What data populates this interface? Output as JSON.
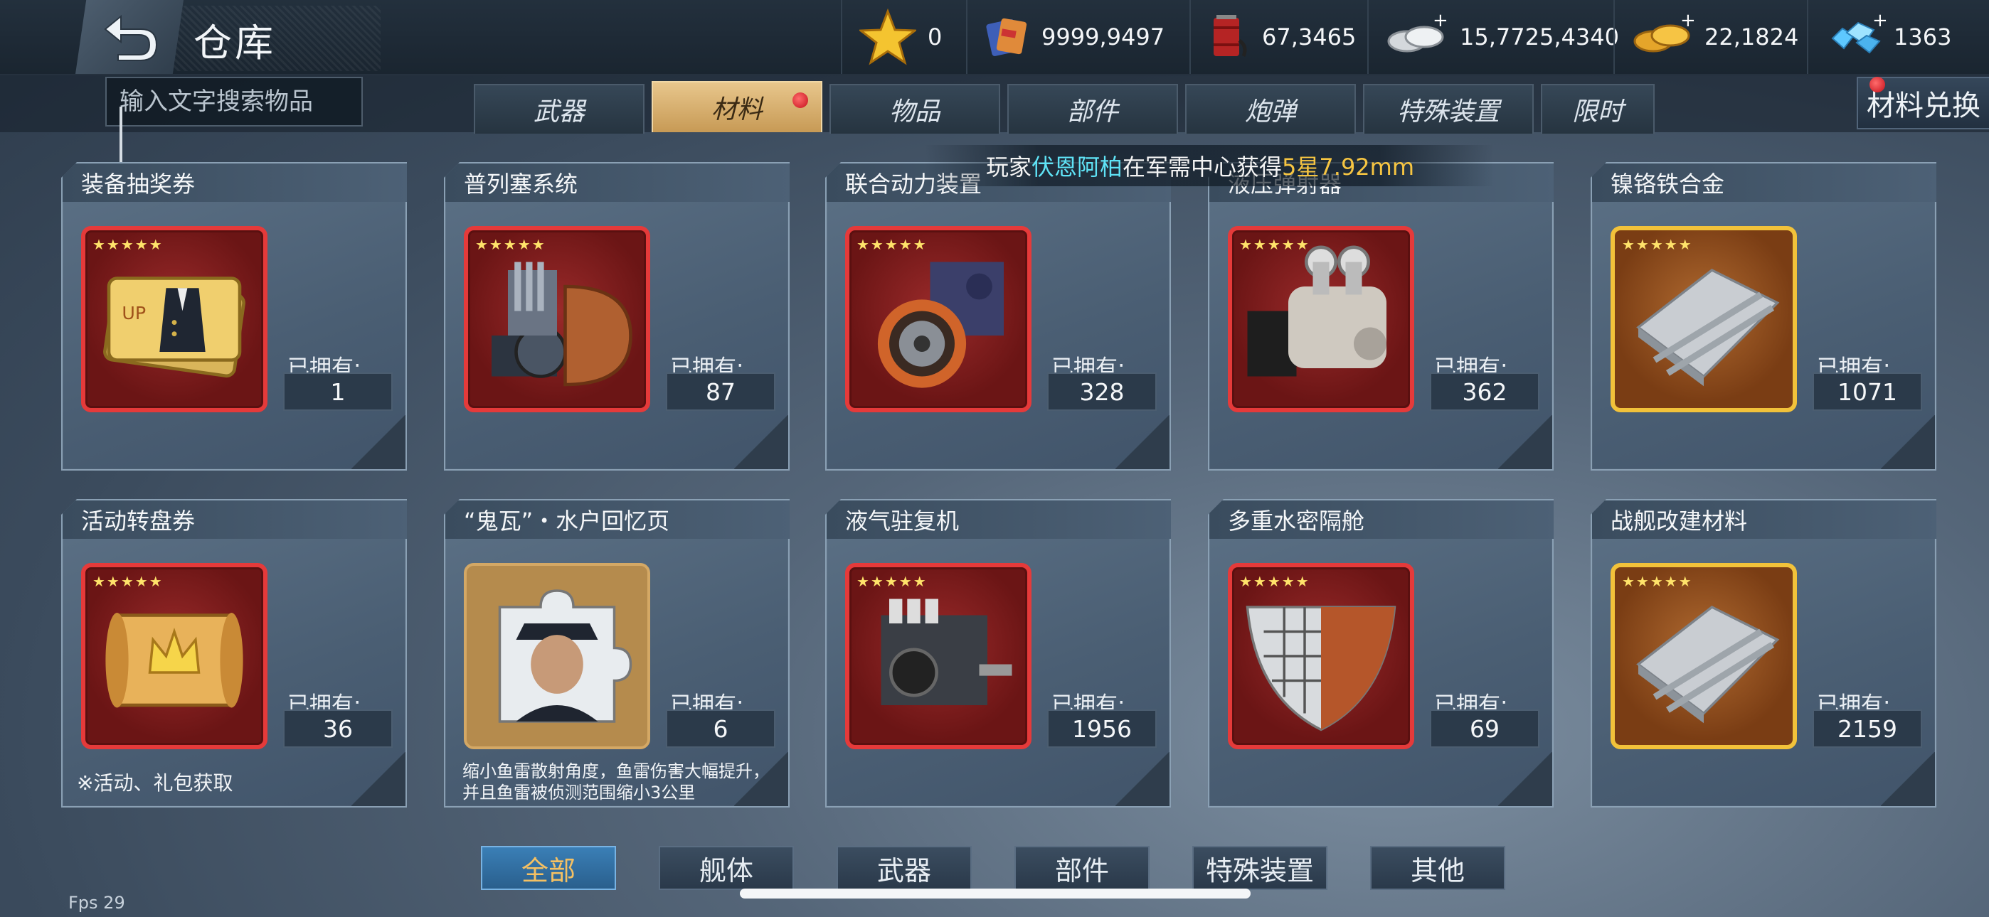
{
  "header": {
    "title": "仓库",
    "resources": [
      {
        "icon": "star-icon",
        "value": "0",
        "has_plus": false
      },
      {
        "icon": "supply-crate-icon",
        "value": "9999,9497",
        "has_plus": false
      },
      {
        "icon": "oil-barrel-icon",
        "value": "67,3465",
        "has_plus": false
      },
      {
        "icon": "silver-coins-icon",
        "value": "15,7725,4340",
        "has_plus": true
      },
      {
        "icon": "gold-coins-icon",
        "value": "22,1824",
        "has_plus": true
      },
      {
        "icon": "diamond-icon",
        "value": "1363",
        "has_plus": true
      }
    ],
    "plus": "+"
  },
  "search": {
    "placeholder": "输入文字搜索物品"
  },
  "tabs": [
    {
      "label": "武器",
      "active": false
    },
    {
      "label": "材料",
      "active": true,
      "badge": true
    },
    {
      "label": "物品",
      "active": false
    },
    {
      "label": "部件",
      "active": false
    },
    {
      "label": "炮弹",
      "active": false
    },
    {
      "label": "特殊装置",
      "active": false
    },
    {
      "label": "限时",
      "active": false
    }
  ],
  "exchange_label": "材料兑换",
  "ticker": {
    "prefix": "玩家",
    "player": "伏恩阿柏",
    "middle": "在军需中心获得",
    "item": "5星7.92mm"
  },
  "owned_label": "已拥有:",
  "cards": [
    {
      "title": "装备抽奖券",
      "count": "1",
      "stars": "★★★★★",
      "frame": "red",
      "icon": "ticket-icon"
    },
    {
      "title": "普列塞系统",
      "count": "87",
      "stars": "★★★★★",
      "frame": "red",
      "icon": "engine-system-icon"
    },
    {
      "title": "联合动力装置",
      "count": "328",
      "stars": "★★★★★",
      "frame": "red",
      "icon": "turbine-icon"
    },
    {
      "title": "液压弹射器",
      "count": "362",
      "stars": "★★★★★",
      "frame": "red",
      "icon": "catapult-machine-icon"
    },
    {
      "title": "镍铬铁合金",
      "count": "1071",
      "stars": "★★★★★",
      "frame": "gold",
      "icon": "metal-plate-icon"
    },
    {
      "title": "活动转盘券",
      "count": "36",
      "stars": "★★★★★",
      "frame": "red",
      "icon": "scroll-crown-icon",
      "note": "※活动、礼包获取"
    },
    {
      "title": "“鬼瓦”・水户回忆页",
      "count": "6",
      "stars": "",
      "frame": "plain",
      "icon": "puzzle-portrait-icon",
      "desc": "缩小鱼雷散射角度，鱼雷伤害大幅提升，并且鱼雷被侦测范围缩小3公里"
    },
    {
      "title": "液气驻复机",
      "count": "1956",
      "stars": "★★★★★",
      "frame": "red",
      "icon": "recoil-machine-icon"
    },
    {
      "title": "多重水密隔舱",
      "count": "69",
      "stars": "★★★★★",
      "frame": "red",
      "icon": "hull-section-icon"
    },
    {
      "title": "战舰改建材料",
      "count": "2159",
      "stars": "★★★★★",
      "frame": "gold",
      "icon": "metal-plate-icon"
    }
  ],
  "filters": [
    {
      "label": "全部",
      "active": true
    },
    {
      "label": "舰体",
      "active": false
    },
    {
      "label": "武器",
      "active": false
    },
    {
      "label": "部件",
      "active": false
    },
    {
      "label": "特殊装置",
      "active": false
    },
    {
      "label": "其他",
      "active": false
    }
  ],
  "fps": "Fps 29"
}
